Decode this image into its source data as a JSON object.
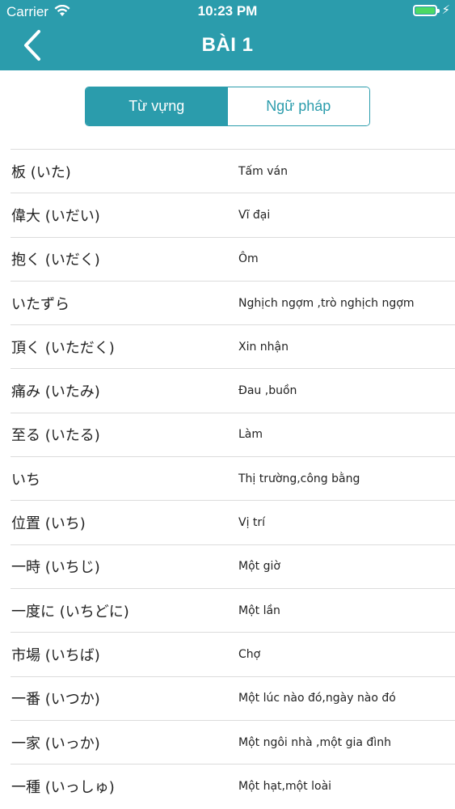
{
  "status_bar": {
    "carrier": "Carrier",
    "time": "10:23 PM"
  },
  "header": {
    "title": "BÀI 1",
    "back_icon": "chevron-left-icon",
    "color": "#2B9CAC"
  },
  "tabs": [
    {
      "label": "Từ vựng",
      "active": true
    },
    {
      "label": "Ngữ pháp",
      "active": false
    }
  ],
  "vocab": [
    {
      "term": "板 (いた)",
      "meaning": "Tấm ván"
    },
    {
      "term": "偉大 (いだい)",
      "meaning": "Vĩ đại"
    },
    {
      "term": "抱く (いだく)",
      "meaning": "Ôm"
    },
    {
      "term": "いたずら",
      "meaning": "Nghịch ngợm ,trò nghịch ngợm"
    },
    {
      "term": "頂く (いただく)",
      "meaning": "Xin nhận"
    },
    {
      "term": "痛み (いたみ)",
      "meaning": "Đau ,buồn"
    },
    {
      "term": "至る (いたる)",
      "meaning": "Làm"
    },
    {
      "term": "いち",
      "meaning": "Thị trường,công bằng"
    },
    {
      "term": "位置 (いち)",
      "meaning": "Vị trí"
    },
    {
      "term": "一時 (いちじ)",
      "meaning": "Một giờ"
    },
    {
      "term": "一度に (いちどに)",
      "meaning": "Một lần"
    },
    {
      "term": "市場 (いちば)",
      "meaning": "Chợ"
    },
    {
      "term": "一番 (いつか)",
      "meaning": "Một lúc nào đó,ngày nào đó"
    },
    {
      "term": "一家 (いっか)",
      "meaning": "Một ngôi nhà ,một gia đình"
    },
    {
      "term": "一種 (いっしゅ)",
      "meaning": "Một hạt,một loài"
    }
  ]
}
